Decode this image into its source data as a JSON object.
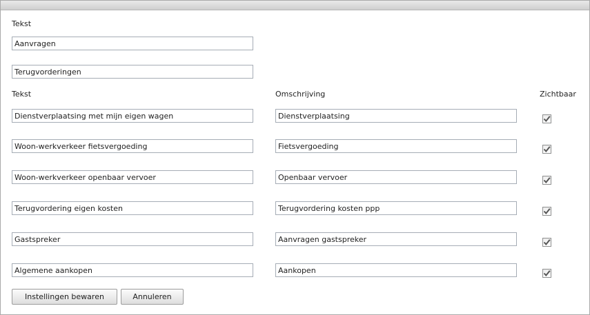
{
  "top_section": {
    "label": "Tekst",
    "fields": [
      {
        "value": "Aanvragen"
      },
      {
        "value": "Terugvorderingen"
      }
    ]
  },
  "columns": {
    "text": "Tekst",
    "description": "Omschrijving",
    "visible": "Zichtbaar"
  },
  "rows": [
    {
      "text": "Dienstverplaatsing met mijn eigen wagen",
      "description": "Dienstverplaatsing",
      "visible": true
    },
    {
      "text": "Woon-werkverkeer fietsvergoeding",
      "description": "Fietsvergoeding",
      "visible": true
    },
    {
      "text": "Woon-werkverkeer openbaar vervoer",
      "description": "Openbaar vervoer",
      "visible": true
    },
    {
      "text": "Terugvordering eigen kosten",
      "description": "Terugvordering kosten ppp",
      "visible": true
    },
    {
      "text": "Gastspreker",
      "description": "Aanvragen gastspreker",
      "visible": true
    },
    {
      "text": "Algemene aankopen",
      "description": "Aankopen",
      "visible": true
    }
  ],
  "buttons": {
    "save": "Instellingen bewaren",
    "cancel": "Annuleren"
  },
  "icons": {
    "checkmark": "checkmark-icon"
  },
  "colors": {
    "border": "#a5acb5",
    "check": "#555555"
  }
}
